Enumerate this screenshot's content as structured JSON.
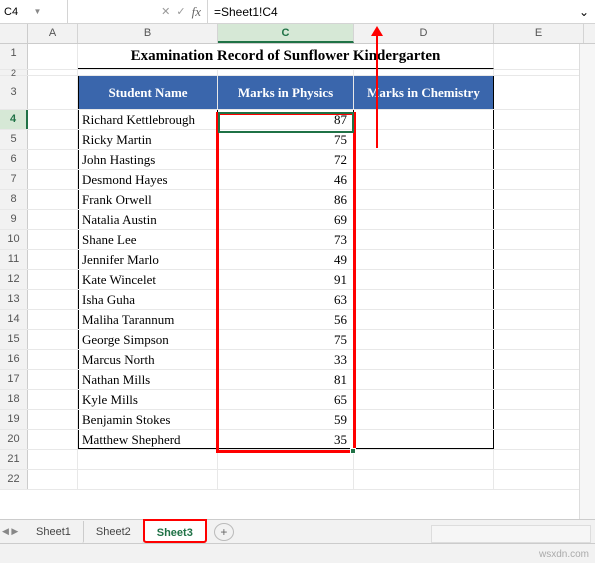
{
  "name_box": "C4",
  "formula": "=Sheet1!C4",
  "columns": [
    "A",
    "B",
    "C",
    "D",
    "E"
  ],
  "title": "Examination Record of Sunflower Kindergarten",
  "headers": {
    "b": "Student Name",
    "c": "Marks in Physics",
    "d": "Marks in Chemistry"
  },
  "rows": [
    {
      "n": 4,
      "name": "Richard Kettlebrough",
      "physics": 87
    },
    {
      "n": 5,
      "name": "Ricky Martin",
      "physics": 75
    },
    {
      "n": 6,
      "name": "John Hastings",
      "physics": 72
    },
    {
      "n": 7,
      "name": "Desmond Hayes",
      "physics": 46
    },
    {
      "n": 8,
      "name": "Frank Orwell",
      "physics": 86
    },
    {
      "n": 9,
      "name": "Natalia Austin",
      "physics": 69
    },
    {
      "n": 10,
      "name": "Shane Lee",
      "physics": 73
    },
    {
      "n": 11,
      "name": "Jennifer Marlo",
      "physics": 49
    },
    {
      "n": 12,
      "name": "Kate Wincelet",
      "physics": 91
    },
    {
      "n": 13,
      "name": "Isha Guha",
      "physics": 63
    },
    {
      "n": 14,
      "name": "Maliha Tarannum",
      "physics": 56
    },
    {
      "n": 15,
      "name": "George Simpson",
      "physics": 75
    },
    {
      "n": 16,
      "name": "Marcus North",
      "physics": 33
    },
    {
      "n": 17,
      "name": "Nathan Mills",
      "physics": 81
    },
    {
      "n": 18,
      "name": "Kyle Mills",
      "physics": 65
    },
    {
      "n": 19,
      "name": "Benjamin Stokes",
      "physics": 59
    },
    {
      "n": 20,
      "name": "Matthew Shepherd",
      "physics": 35
    }
  ],
  "extra_rows": [
    21,
    22
  ],
  "tabs": {
    "t1": "Sheet1",
    "t2": "Sheet2",
    "t3": "Sheet3"
  },
  "watermark": "wsxdn.com"
}
